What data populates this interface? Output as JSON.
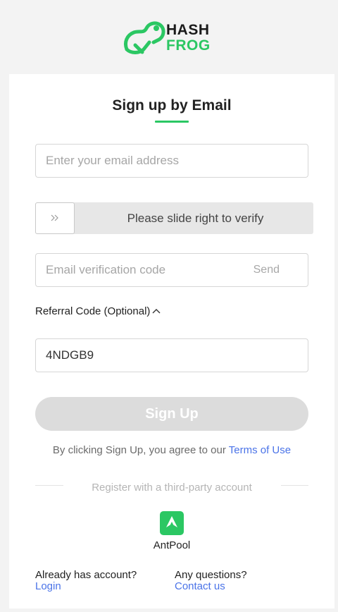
{
  "brand": {
    "line1": "HASH",
    "line2": "FROG",
    "accent": "#2bc763",
    "logo_icon": "frog-icon"
  },
  "form": {
    "title": "Sign up by Email",
    "email_placeholder": "Enter your email address",
    "slider_text": "Please slide right to verify",
    "slider_icon": "double-chevron-right-icon",
    "code_placeholder": "Email verification code",
    "send_label": "Send",
    "referral_label": "Referral Code (Optional)",
    "referral_value": "4NDGB9",
    "signup_label": "Sign Up",
    "terms_prefix": "By clicking Sign Up, you agree to our ",
    "terms_link": "Terms of Use"
  },
  "third_party": {
    "divider_text": "Register with a third-party account",
    "provider_label": "AntPool",
    "provider_icon": "antpool-icon"
  },
  "footer": {
    "account_question": "Already has account?",
    "login_link": "Login",
    "help_question": "Any questions?",
    "contact_link": "Contact us"
  },
  "colors": {
    "link": "#4a73e8",
    "disabled_button": "#dcdcdc"
  }
}
